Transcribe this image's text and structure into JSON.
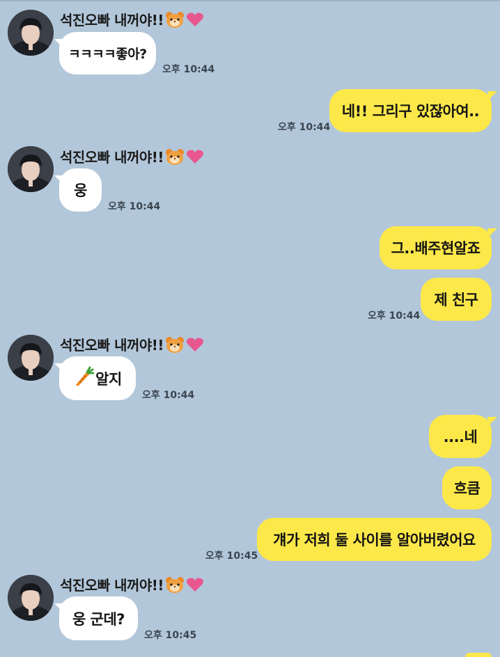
{
  "chat": {
    "sender_name": "석진오빠 내꺼야!!",
    "colors": {
      "background": "#b3c7da",
      "received_bubble": "#ffffff",
      "sent_bubble": "#fde84a"
    },
    "messages": [
      {
        "side": "received",
        "text": "ㅋㅋㅋㅋ좋아?",
        "time": "오후 10:44"
      },
      {
        "side": "sent",
        "text": "네!! 그리구 있잖아여..",
        "time": "오후 10:44"
      },
      {
        "side": "received",
        "text": "웅",
        "time": "오후 10:44"
      },
      {
        "side": "sent",
        "text": "그..배주현알죠",
        "time": ""
      },
      {
        "side": "sent",
        "text": "제 친구",
        "time": "오후 10:44"
      },
      {
        "side": "received",
        "icon": "carrot-icon",
        "text": "알지",
        "time": "오후 10:44"
      },
      {
        "side": "sent",
        "text": "....네",
        "time": ""
      },
      {
        "side": "sent",
        "text": "흐큼",
        "time": ""
      },
      {
        "side": "sent",
        "text": "걔가 저희 둘 사이를 알아버렸어요",
        "time": "오후 10:45"
      },
      {
        "side": "received",
        "text": "웅 군데?",
        "time": "오후 10:45"
      }
    ],
    "sender_emojis": [
      "hamster-face-icon",
      "pink-heart-icon"
    ]
  }
}
